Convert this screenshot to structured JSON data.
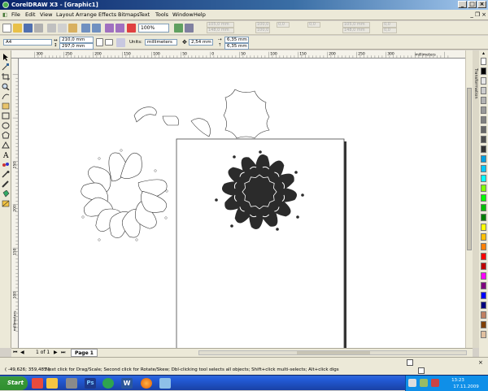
{
  "window": {
    "title": "CorelDRAW X3 - [Graphic1]"
  },
  "menu": [
    "File",
    "Edit",
    "View",
    "Layout",
    "Arrange",
    "Effects",
    "Bitmaps",
    "Text",
    "Tools",
    "Window",
    "Help"
  ],
  "toolbar": {
    "zoom": "100%"
  },
  "ghost_fields": [
    "105,0 mm",
    "148,0 mm",
    "100,0",
    "100,0",
    "0,0",
    "0,0",
    "105,0 mm",
    "148,0 mm",
    "0,0",
    "0,0"
  ],
  "property_bar": {
    "page_size": "A4",
    "width": "210,0 mm",
    "height": "297,0 mm",
    "units_label": "Units:",
    "units_value": "millimeters",
    "nudge": "2,54 mm",
    "dup_x": "6,35 mm",
    "dup_y": "6,35 mm"
  },
  "ruler": {
    "h_ticks": [
      "300",
      "250",
      "200",
      "150",
      "100",
      "50",
      "0",
      "50",
      "100",
      "150",
      "200",
      "250",
      "300"
    ],
    "v_ticks": [
      "250",
      "200",
      "150",
      "100"
    ],
    "h_unit": "millimeters",
    "v_unit": "millimeters"
  },
  "docker": {
    "tab": "Transformation"
  },
  "page_nav": {
    "counter": "1 of 1",
    "tab": "Page 1"
  },
  "status": {
    "coords": "( -49,626; 359,485 )",
    "hint": "Next click for Drag/Scale; Second click for Rotate/Skew; Dbl-clicking tool selects all objects; Shift+click multi-selects; Alt+click digs"
  },
  "taskbar": {
    "start": "Start",
    "time": "13:23",
    "date": "17.11.2009"
  },
  "palette_colors": [
    "#ffffff",
    "#000000",
    "#e6e6e6",
    "#cccccc",
    "#b3b3b3",
    "#999999",
    "#808080",
    "#666666",
    "#4d4d4d",
    "#333333",
    "#00a0e0",
    "#00c8ff",
    "#00ffff",
    "#80ff00",
    "#00ff00",
    "#00c000",
    "#008000",
    "#ffff00",
    "#ffc000",
    "#ff8000",
    "#ff0000",
    "#c00000",
    "#ff00ff",
    "#800080",
    "#0000ff",
    "#000080",
    "#c08060",
    "#804000",
    "#e0c0a0"
  ],
  "colors": {
    "ornament": "#2b2b2b",
    "titlebar": "#0a246a",
    "taskbar": "#245edb"
  }
}
